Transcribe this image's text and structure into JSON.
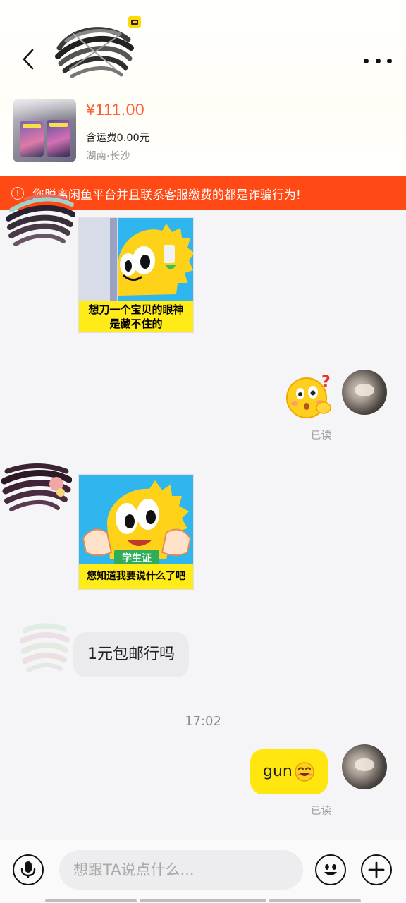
{
  "header": {
    "back_icon": "chevron-left-icon",
    "more_icon": "more-dots-icon"
  },
  "product": {
    "price": "¥111.00",
    "shipping": "含运费0.00元",
    "location": "湖南·长沙"
  },
  "warning": {
    "text": "您脱离闲鱼平台并且联系客服缴费的都是诈骗行为!",
    "color": "#ff4a16"
  },
  "messages": {
    "sticker1_caption_line1": "想刀一个宝贝的眼神",
    "sticker1_caption_line2": "是藏不住的",
    "sticker2_badge": "学生证",
    "sticker2_caption": "您知道我要说什么了吧",
    "read1": "已读",
    "bubble_left": "1元包邮行吗",
    "time": "17:02",
    "bubble_right": "gun",
    "read2": "已读"
  },
  "input": {
    "placeholder": "想跟TA说点什么...",
    "voice_icon": "microphone-icon",
    "emoji_icon": "emoji-icon",
    "plus_icon": "plus-icon"
  },
  "colors": {
    "accent_yellow": "#ffe60f",
    "price_red": "#ff5c3a"
  }
}
